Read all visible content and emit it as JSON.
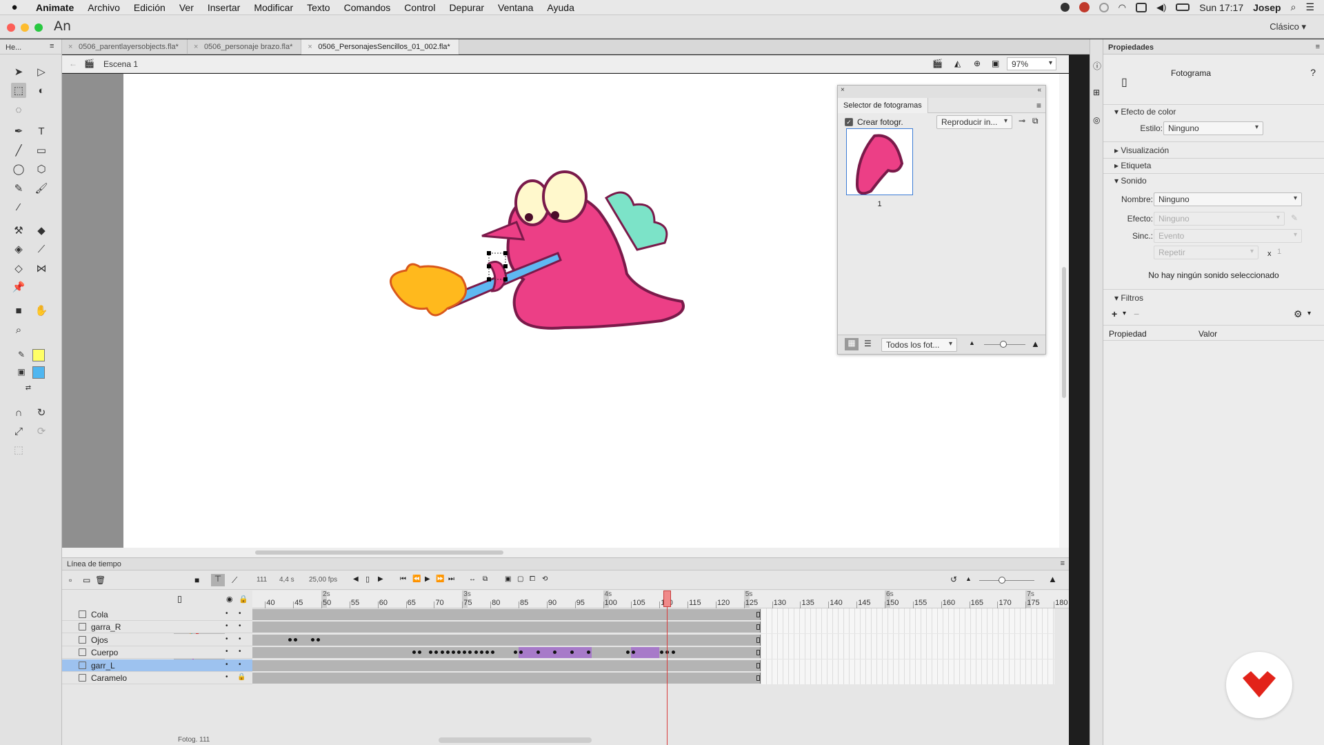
{
  "menubar": {
    "app_name": "Animate",
    "items": [
      "Archivo",
      "Edición",
      "Ver",
      "Insertar",
      "Modificar",
      "Texto",
      "Comandos",
      "Control",
      "Depurar",
      "Ventana",
      "Ayuda"
    ],
    "clock": "Sun 17:17",
    "user": "Josep"
  },
  "titlebar": {
    "logo": "An",
    "workspace": "Clásico"
  },
  "tabs": [
    {
      "label": "0506_parentlayersobjects.fla*"
    },
    {
      "label": "0506_personaje brazo.fla*"
    },
    {
      "label": "0506_PersonajesSencillos_01_002.fla*",
      "active": true
    }
  ],
  "tools_panel": {
    "header": "He..."
  },
  "stage": {
    "scene": "Escena 1",
    "zoom": "97%"
  },
  "frame_picker": {
    "title": "Selector de fotogramas",
    "create_frame_label": "Crear fotogr.",
    "create_frame_checked": true,
    "play_mode": "Reproducir in...",
    "thumb_number": "1",
    "filter": "Todos los fot..."
  },
  "properties": {
    "title": "Propiedades",
    "object_type": "Fotograma",
    "color_effect": "Efecto de color",
    "style_label": "Estilo:",
    "style_value": "Ninguno",
    "display": "Visualización",
    "label": "Etiqueta",
    "sound": "Sonido",
    "name_label": "Nombre:",
    "name_value": "Ninguno",
    "effect_label": "Efecto:",
    "effect_value": "Ninguno",
    "sync_label": "Sinc.:",
    "sync_value": "Evento",
    "repeat_value": "Repetir",
    "repeat_x": "x",
    "repeat_count": "1",
    "no_sound": "No hay ningún sonido seleccionado",
    "filters": "Filtros",
    "col_property": "Propiedad",
    "col_value": "Valor"
  },
  "timeline": {
    "title": "Línea de tiempo",
    "current_frame": "111",
    "time": "4,4 s",
    "fps": "25,00 fps",
    "footer": "Fotog. 111",
    "ruler_start": 38,
    "ruler_end": 182,
    "ruler_labels": [
      "40",
      "45",
      "50",
      "55",
      "60",
      "65",
      "70",
      "75",
      "80",
      "85",
      "90",
      "95",
      "100",
      "105",
      "110",
      "115",
      "120",
      "125",
      "130",
      "135",
      "140",
      "145",
      "150",
      "155",
      "160",
      "165",
      "170",
      "175",
      "180"
    ],
    "seconds": [
      {
        "label": "2s",
        "frame": 50
      },
      {
        "label": "3s",
        "frame": 75
      },
      {
        "label": "4s",
        "frame": 100
      },
      {
        "label": "5s",
        "frame": 125
      },
      {
        "label": "6s",
        "frame": 150
      },
      {
        "label": "7s",
        "frame": 175
      }
    ],
    "playhead_frame": 111,
    "layers": [
      {
        "name": "Cola",
        "color": "#3aa7a7",
        "end": 128,
        "keys": []
      },
      {
        "name": "garra_R",
        "color": "#e38a2b",
        "end": 128,
        "keys": []
      },
      {
        "name": "Ojos",
        "color": "#d12b2b",
        "end": 128,
        "keys": [
          44,
          45,
          48,
          49
        ]
      },
      {
        "name": "Cuerpo",
        "color": "#8e3fb3",
        "end": 128,
        "keys": [
          66,
          67,
          69,
          70,
          71,
          72,
          73,
          74,
          75,
          76,
          77,
          78,
          79,
          80,
          84,
          85,
          88,
          91,
          94,
          97,
          104,
          105,
          110,
          111,
          112
        ],
        "tweens": [
          [
            85,
            98
          ],
          [
            105,
            110
          ]
        ]
      },
      {
        "name": "garr_L",
        "color": "#c23bb8",
        "end": 128,
        "keys": [],
        "selected": true
      },
      {
        "name": "Caramelo",
        "color": "#5e9e2e",
        "end": 128,
        "keys": [],
        "locked": true
      }
    ]
  },
  "colors": {
    "stroke": "#ffff66",
    "fill": "#4fb6f0",
    "accent": "#3a7bd5",
    "tween": "#a77ac9",
    "playhead": "#d93c3c"
  }
}
